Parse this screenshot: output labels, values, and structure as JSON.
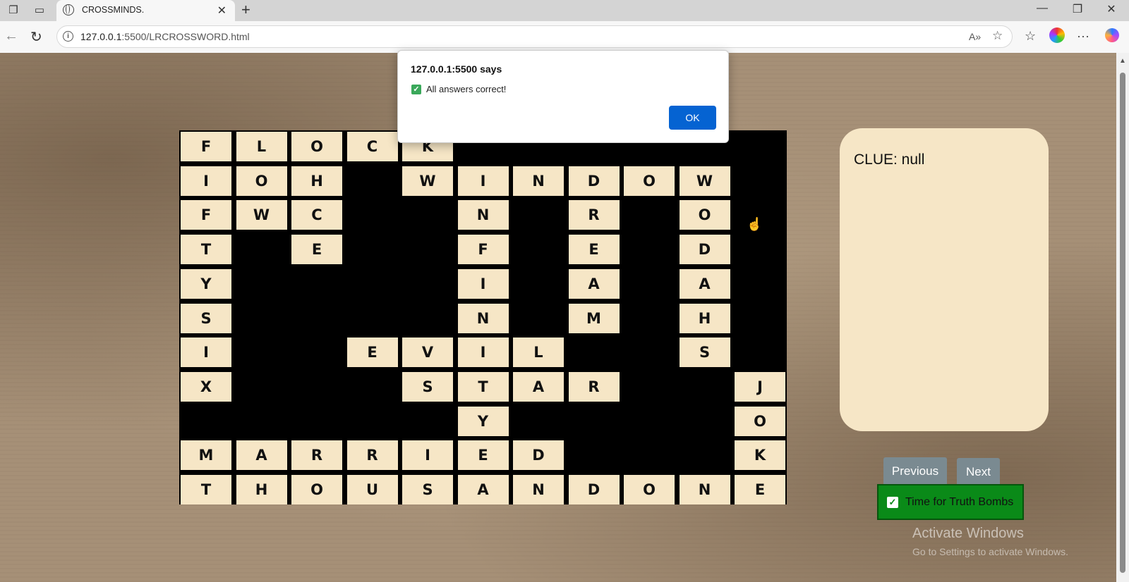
{
  "browser": {
    "tab_title": "CROSSMINDS.",
    "url_host": "127.0.0.1",
    "url_path": ":5500/LRCROSSWORD.html"
  },
  "dialog": {
    "origin": "127.0.0.1:5500 says",
    "message": "All answers correct!",
    "ok_label": "OK"
  },
  "crossword": {
    "rows": [
      "FLOCK######",
      "IOH#WINDOW#",
      "FWC##N#R#O#",
      "T#E##F#E#D#",
      "Y####I#A#A#",
      "S####N#M#H#",
      "I##EVIL##S#",
      "X###STAR##J",
      "#####Y####O",
      "MARRIED###K",
      "THOUSANDONE"
    ]
  },
  "clue": {
    "text": "CLUE: null"
  },
  "buttons": {
    "previous": "Previous",
    "next": "Next",
    "truth_bombs": "Time for Truth Bombs"
  },
  "watermark": {
    "title": "Activate Windows",
    "subtitle": "Go to Settings to activate Windows."
  }
}
